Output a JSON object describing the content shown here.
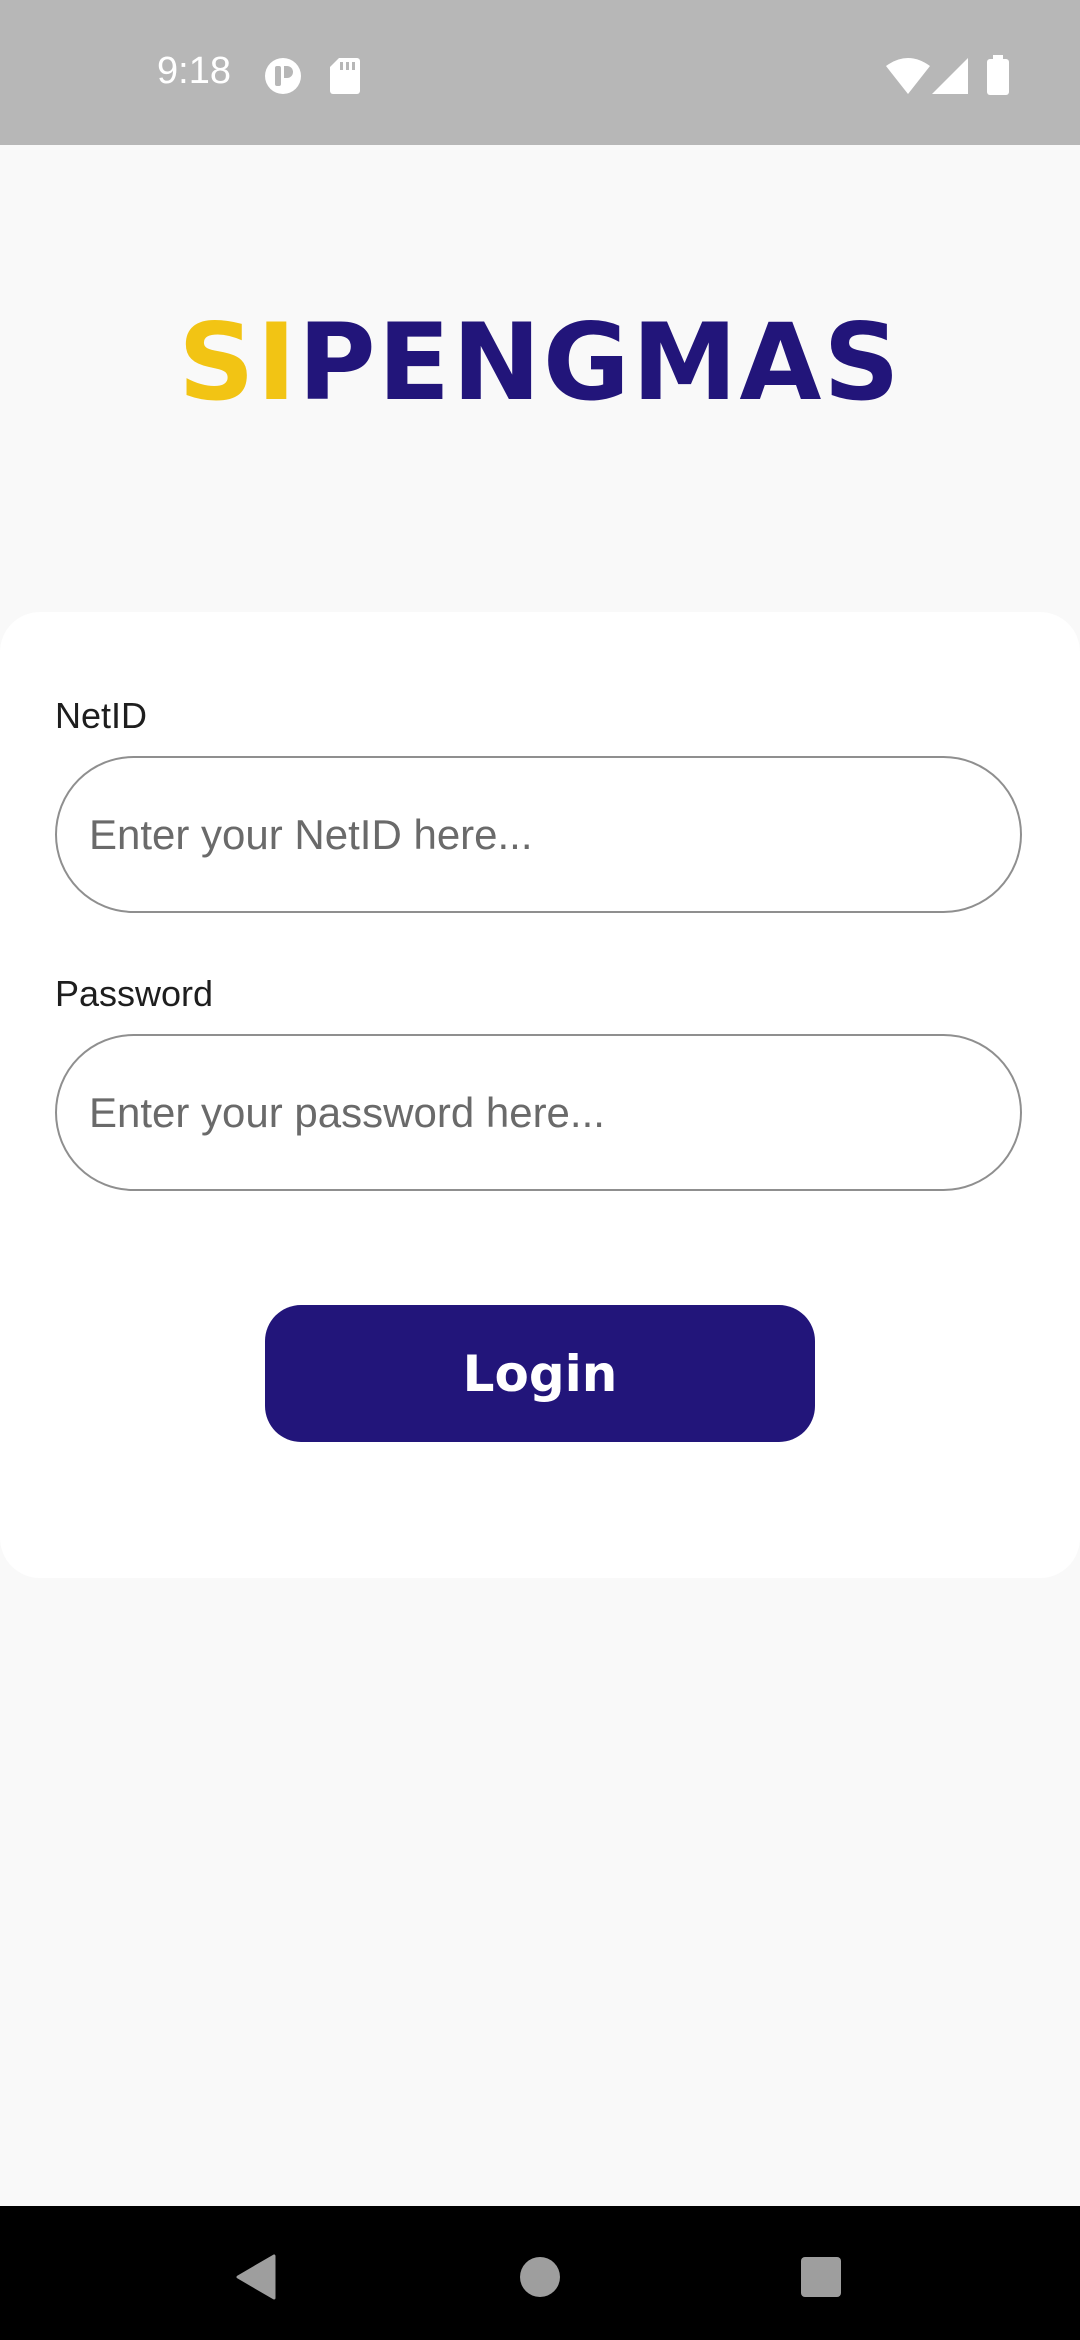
{
  "status_bar": {
    "time": "9:18",
    "left_icons": [
      "app-notification-icon",
      "sd-card-icon"
    ],
    "right_icons": [
      "wifi-icon",
      "cell-signal-icon",
      "battery-icon"
    ]
  },
  "logo": {
    "accent_text": "SI",
    "main_text": "PENGMAS",
    "accent_color": "#f2c414",
    "main_color": "#22157a"
  },
  "form": {
    "netid": {
      "label": "NetID",
      "value": "",
      "placeholder": "Enter your NetID here..."
    },
    "password": {
      "label": "Password",
      "value": "",
      "placeholder": "Enter your password here..."
    },
    "login_label": "Login",
    "button_color": "#22157a"
  },
  "nav_bar": {
    "buttons": [
      "back-icon",
      "home-icon",
      "recents-icon"
    ]
  }
}
